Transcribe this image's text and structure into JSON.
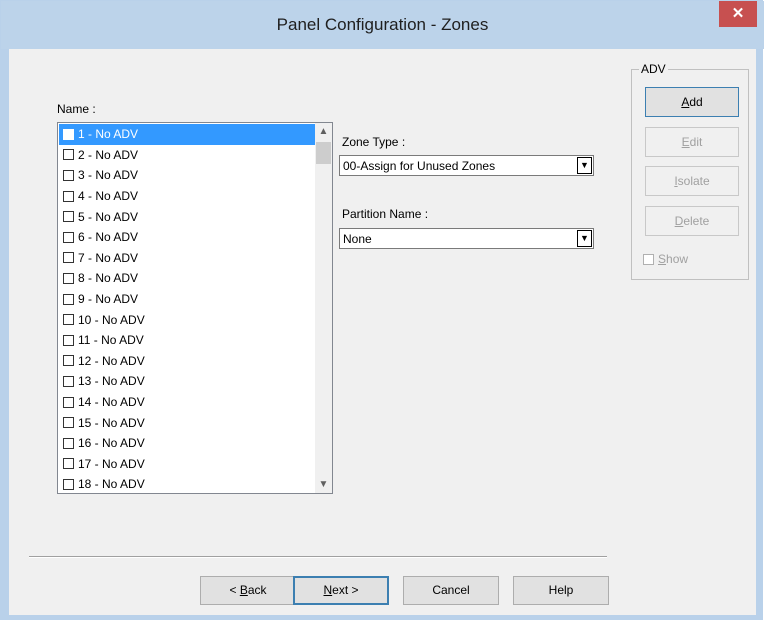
{
  "window": {
    "title": "Panel Configuration - Zones",
    "close_glyph": "✕"
  },
  "name_label": "Name :",
  "zones": [
    "1 - No ADV",
    "2 - No ADV",
    "3 - No ADV",
    "4 - No ADV",
    "5 - No ADV",
    "6 - No ADV",
    "7 - No ADV",
    "8 - No ADV",
    "9 - No ADV",
    "10 - No ADV",
    "11 - No ADV",
    "12 - No ADV",
    "13 - No ADV",
    "14 - No ADV",
    "15 - No ADV",
    "16 - No ADV",
    "17 - No ADV",
    "18 - No ADV"
  ],
  "selected_zone_index": 0,
  "zone_type": {
    "label": "Zone Type :",
    "value": "00-Assign for Unused Zones"
  },
  "partition": {
    "label": "Partition Name :",
    "value": "None"
  },
  "adv_group": {
    "label": "ADV",
    "add": {
      "prefix": "",
      "mnemonic": "A",
      "suffix": "dd"
    },
    "edit": {
      "prefix": "",
      "mnemonic": "E",
      "suffix": "dit"
    },
    "isolate": {
      "prefix": "",
      "mnemonic": "I",
      "suffix": "solate"
    },
    "delete": {
      "prefix": "",
      "mnemonic": "D",
      "suffix": "elete"
    },
    "show": {
      "prefix": "",
      "mnemonic": "S",
      "suffix": "how",
      "checked": false
    }
  },
  "footer": {
    "back": {
      "prefix": "< ",
      "mnemonic": "B",
      "suffix": "ack"
    },
    "next": {
      "prefix": "",
      "mnemonic": "N",
      "suffix": "ext >"
    },
    "cancel": "Cancel",
    "help": "Help"
  },
  "icons": {
    "scroll_up": "chevron-up-icon",
    "scroll_down": "chevron-down-icon",
    "dropdown": "dropdown-arrow-icon"
  },
  "colors": {
    "titlebar": "#bcd3ea",
    "close": "#c75050",
    "selection": "#3399ff",
    "dialog_bg": "#f0f0f0"
  }
}
